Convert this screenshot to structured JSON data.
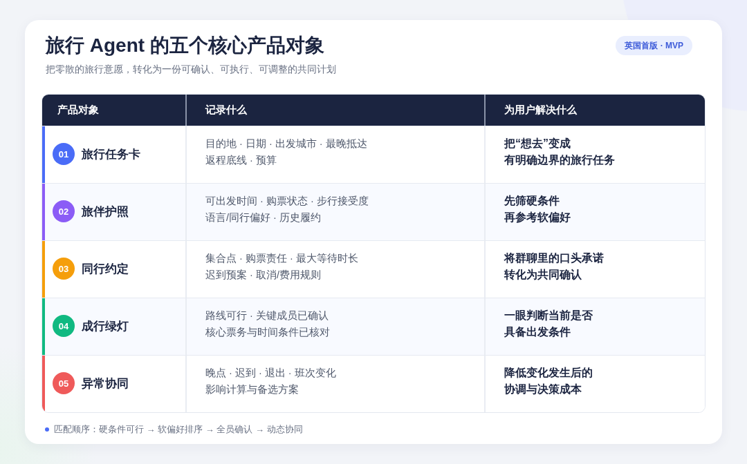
{
  "header": {
    "title": "旅行 Agent 的五个核心产品对象",
    "subtitle": "把零散的旅行意愿，转化为一份可确认、可执行、可调整的共同计划",
    "badge": "英国首版 · MVP"
  },
  "table": {
    "columns": [
      "产品对象",
      "记录什么",
      "为用户解决什么"
    ],
    "rows": [
      {
        "number": "01",
        "name": "旅行任务卡",
        "color": "#4a6cf7",
        "records": [
          "目的地 · 日期 · 出发城市 · 最晚抵达",
          "返程底线 · 预算"
        ],
        "solves": [
          "把“想去”变成",
          "有明确边界的旅行任务"
        ]
      },
      {
        "number": "02",
        "name": "旅伴护照",
        "color": "#8b5cf6",
        "records": [
          "可出发时间 · 购票状态 · 步行接受度",
          "语言/同行偏好 · 历史履约"
        ],
        "solves": [
          "先筛硬条件",
          "再参考软偏好"
        ]
      },
      {
        "number": "03",
        "name": "同行约定",
        "color": "#f59e0b",
        "records": [
          "集合点 · 购票责任 · 最大等待时长",
          "迟到预案 · 取消/费用规则"
        ],
        "solves": [
          "将群聊里的口头承诺",
          "转化为共同确认"
        ]
      },
      {
        "number": "04",
        "name": "成行绿灯",
        "color": "#10b981",
        "records": [
          "路线可行 · 关键成员已确认",
          "核心票务与时间条件已核对"
        ],
        "solves": [
          "一眼判断当前是否",
          "具备出发条件"
        ]
      },
      {
        "number": "05",
        "name": "异常协同",
        "color": "#ef5a5a",
        "records": [
          "晚点 · 迟到 · 退出 · 班次变化",
          "影响计算与备选方案"
        ],
        "solves": [
          "降低变化发生后的",
          "协调与决策成本"
        ]
      }
    ]
  },
  "footer": {
    "note": "匹配顺序：硬条件可行 → 软偏好排序 → 全员确认 → 动态协同"
  }
}
